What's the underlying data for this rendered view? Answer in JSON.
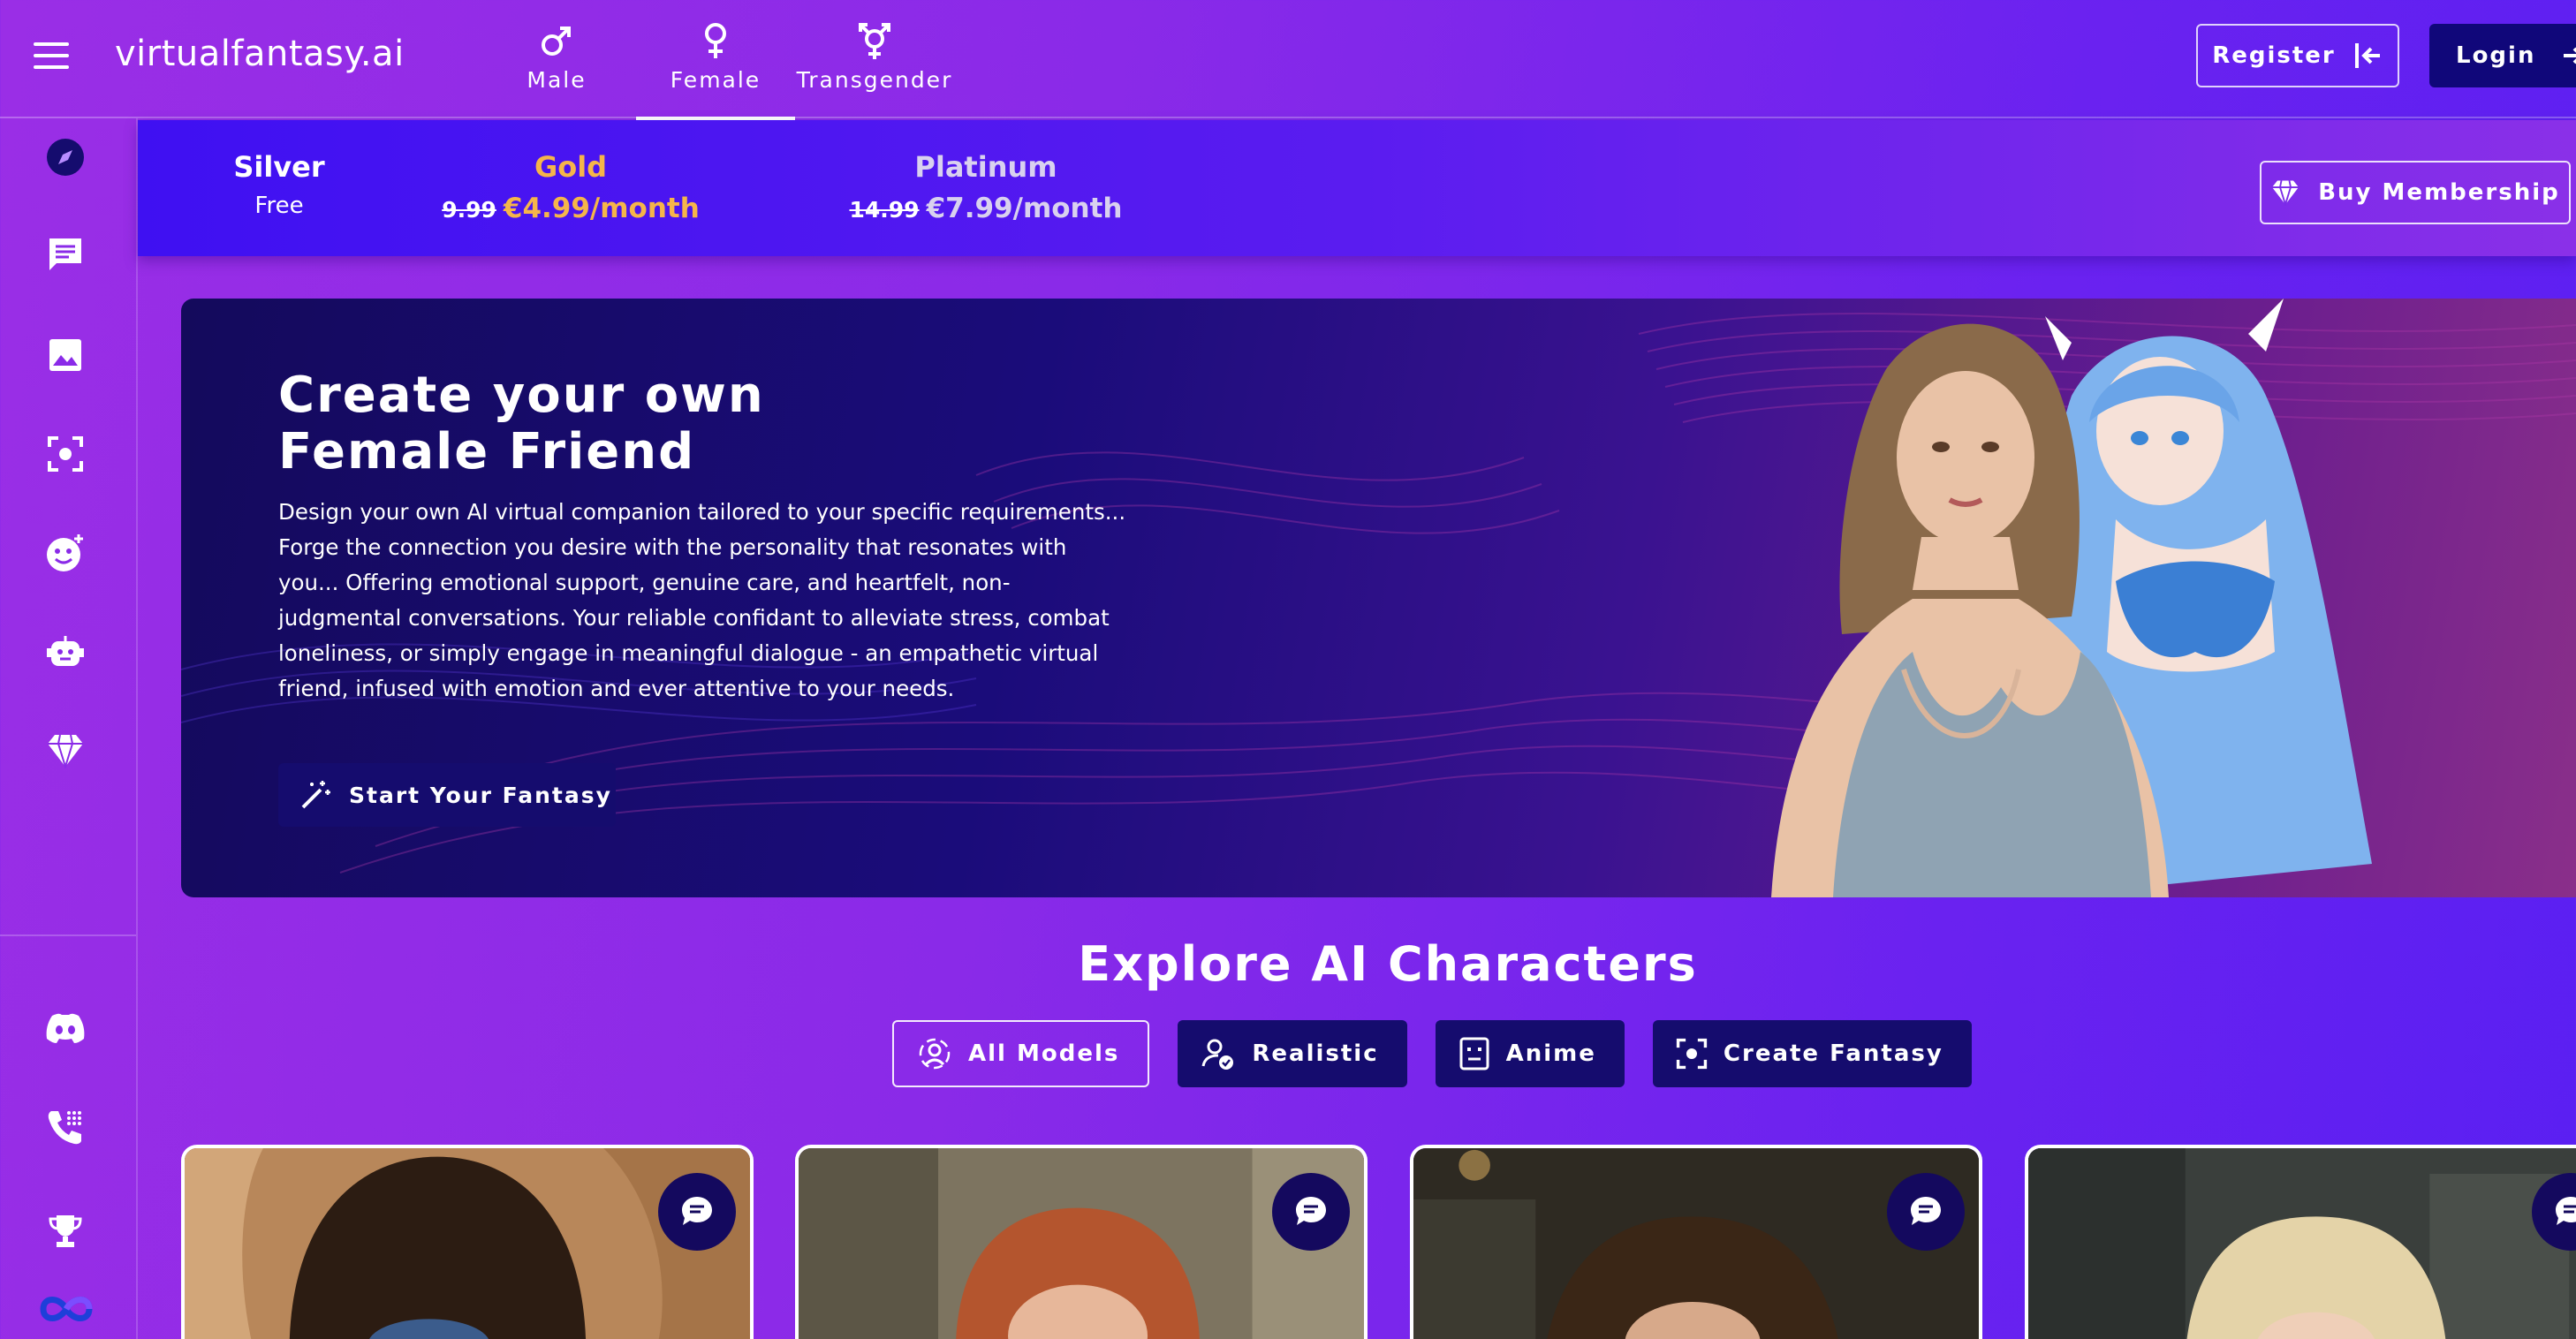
{
  "header": {
    "brand": "virtualfantasy.ai",
    "gender_tabs": [
      {
        "label": "Male",
        "icon": "male-symbol-icon",
        "active": false
      },
      {
        "label": "Female",
        "icon": "female-symbol-icon",
        "active": true
      },
      {
        "label": "Transgender",
        "icon": "transgender-symbol-icon",
        "active": false
      }
    ],
    "register_label": "Register",
    "login_label": "Login"
  },
  "sidebar": {
    "items": [
      {
        "icon": "compass-icon"
      },
      {
        "icon": "chat-icon"
      },
      {
        "icon": "image-icon"
      },
      {
        "icon": "focus-capture-icon"
      },
      {
        "icon": "emoji-add-icon"
      },
      {
        "icon": "robot-icon"
      },
      {
        "icon": "diamond-icon"
      }
    ],
    "bottom_items": [
      {
        "icon": "discord-icon"
      },
      {
        "icon": "phone-dialpad-icon"
      },
      {
        "icon": "trophy-icon"
      },
      {
        "icon": "infinity-icon"
      }
    ]
  },
  "membership": {
    "silver": {
      "name": "Silver",
      "price": "Free"
    },
    "gold": {
      "name": "Gold",
      "old_price": "9.99",
      "price": "€4.99/month"
    },
    "platinum": {
      "name": "Platinum",
      "old_price": "14.99",
      "price": "€7.99/month"
    },
    "buy_label": "Buy Membership"
  },
  "hero": {
    "title": "Create your own Female Friend",
    "description": "Design your own AI virtual companion tailored to your specific requirements... Forge the connection you desire with the personality that resonates with you... Offering emotional support, genuine care, and heartfelt, non-judgmental conversations. Your reliable confidant to alleviate stress, combat loneliness, or simply engage in meaningful dialogue - an empathetic virtual friend, infused with emotion and ever attentive to your needs.",
    "cta_label": "Start Your Fantasy"
  },
  "explore": {
    "title": "Explore AI Characters",
    "filters": [
      {
        "label": "All Models",
        "icon": "all-models-icon",
        "active": true
      },
      {
        "label": "Realistic",
        "icon": "verified-user-icon",
        "active": false
      },
      {
        "label": "Anime",
        "icon": "anime-face-icon",
        "active": false
      },
      {
        "label": "Create Fantasy",
        "icon": "focus-capture-icon",
        "active": false
      }
    ]
  },
  "colors": {
    "accent_dark": "#150c6e",
    "gold": "#f5b54a",
    "platinum": "#d9d1ef",
    "background_start": "#9a2ee6",
    "background_end": "#5a1ff2"
  }
}
